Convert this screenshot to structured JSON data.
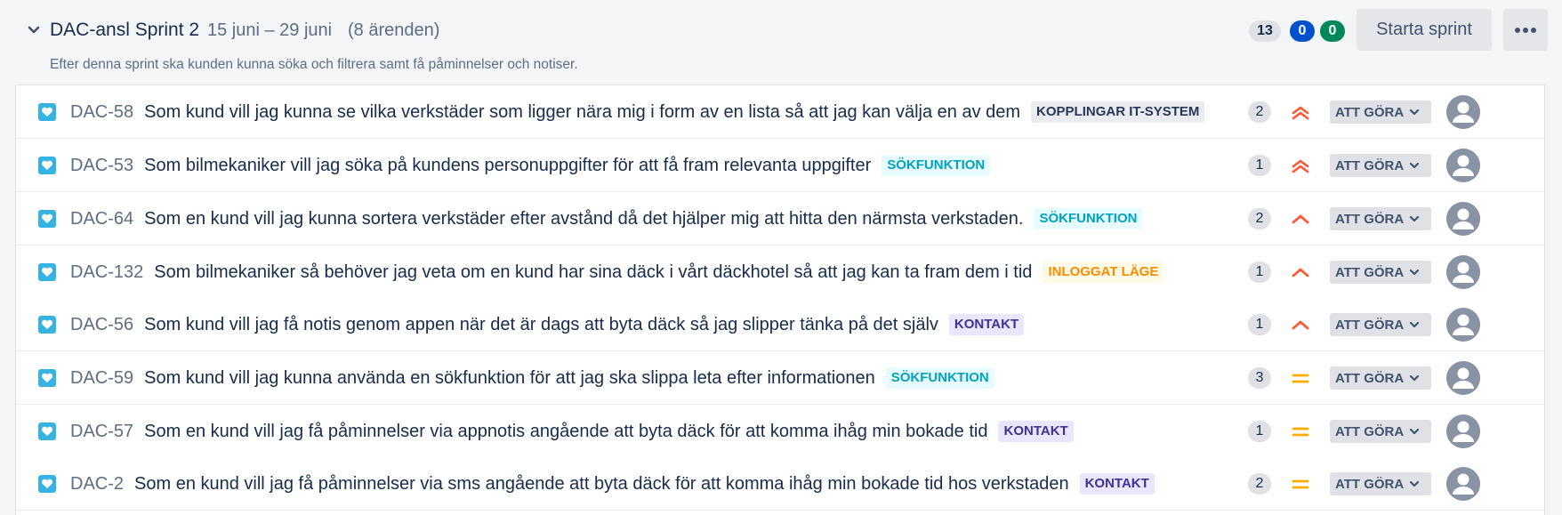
{
  "sprint": {
    "name": "DAC-ansl Sprint 2",
    "dates": "15 juni – 29 juni",
    "issue_count": "(8 ärenden)",
    "goal": "Efter denna sprint ska kunden kunna söka och filtrera samt få påminnelser och notiser.",
    "counters": {
      "todo": "13",
      "in_progress": "0",
      "done": "0"
    },
    "start_label": "Starta sprint"
  },
  "issues": [
    {
      "key": "DAC-58",
      "summary": "Som kund vill jag kunna se vilka verkstäder som ligger nära mig i form av en lista så att jag kan välja en av dem",
      "epic": "KOPPLINGAR IT-SYSTEM",
      "epic_style": "koppl",
      "points": "2",
      "priority": "highest",
      "status": "ATT GÖRA",
      "type_icon": "story-icon"
    },
    {
      "key": "DAC-53",
      "summary": "Som bilmekaniker vill jag söka på kundens personuppgifter för att få fram relevanta uppgifter",
      "epic": "SÖKFUNKTION",
      "epic_style": "sok",
      "points": "1",
      "priority": "highest",
      "status": "ATT GÖRA",
      "type_icon": "story-icon"
    },
    {
      "key": "DAC-64",
      "summary": "Som en kund vill jag kunna sortera verkstäder efter avstånd då det hjälper mig att hitta den närmsta verkstaden.",
      "epic": "SÖKFUNKTION",
      "epic_style": "sok",
      "points": "2",
      "priority": "high",
      "status": "ATT GÖRA",
      "type_icon": "story-icon"
    },
    {
      "key": "DAC-132",
      "summary": "Som bilmekaniker så behöver jag veta om en kund har sina däck i vårt däckhotel så att jag kan ta fram dem i tid",
      "epic": "INLOGGAT LÄGE",
      "epic_style": "inlogg",
      "points": "1",
      "priority": "high",
      "status": "ATT GÖRA",
      "type_icon": "story-icon"
    },
    {
      "key": "DAC-56",
      "summary": "Som kund vill jag få notis genom appen när det är dags att byta däck så jag slipper tänka på det själv",
      "epic": "KONTAKT",
      "epic_style": "kontakt",
      "points": "1",
      "priority": "high",
      "status": "ATT GÖRA",
      "type_icon": "story-icon"
    },
    {
      "key": "DAC-59",
      "summary": "Som kund vill jag kunna använda en sökfunktion för att jag ska slippa leta efter informationen",
      "epic": "SÖKFUNKTION",
      "epic_style": "sok",
      "points": "3",
      "priority": "medium",
      "status": "ATT GÖRA",
      "type_icon": "story-icon"
    },
    {
      "key": "DAC-57",
      "summary": "Som en kund vill jag få påminnelser via appnotis angående att byta däck för att komma ihåg min bokade tid",
      "epic": "KONTAKT",
      "epic_style": "kontakt",
      "points": "1",
      "priority": "medium",
      "status": "ATT GÖRA",
      "type_icon": "story-icon"
    },
    {
      "key": "DAC-2",
      "summary": "Som en kund vill jag få påminnelser via sms angående att byta däck för att komma ihåg min bokade tid hos verkstaden",
      "epic": "KONTAKT",
      "epic_style": "kontakt",
      "points": "2",
      "priority": "medium",
      "status": "ATT GÖRA",
      "type_icon": "story-icon"
    }
  ],
  "colors": {
    "story": "#36b3e0",
    "priority_high": "#ff5630",
    "priority_medium": "#ffab00",
    "counter_in_progress": "#0052cc",
    "counter_done": "#00875a"
  },
  "icons": {
    "collapse": "chevron-down-icon",
    "more": "more-horizontal-icon",
    "avatar": "default-avatar-icon"
  }
}
